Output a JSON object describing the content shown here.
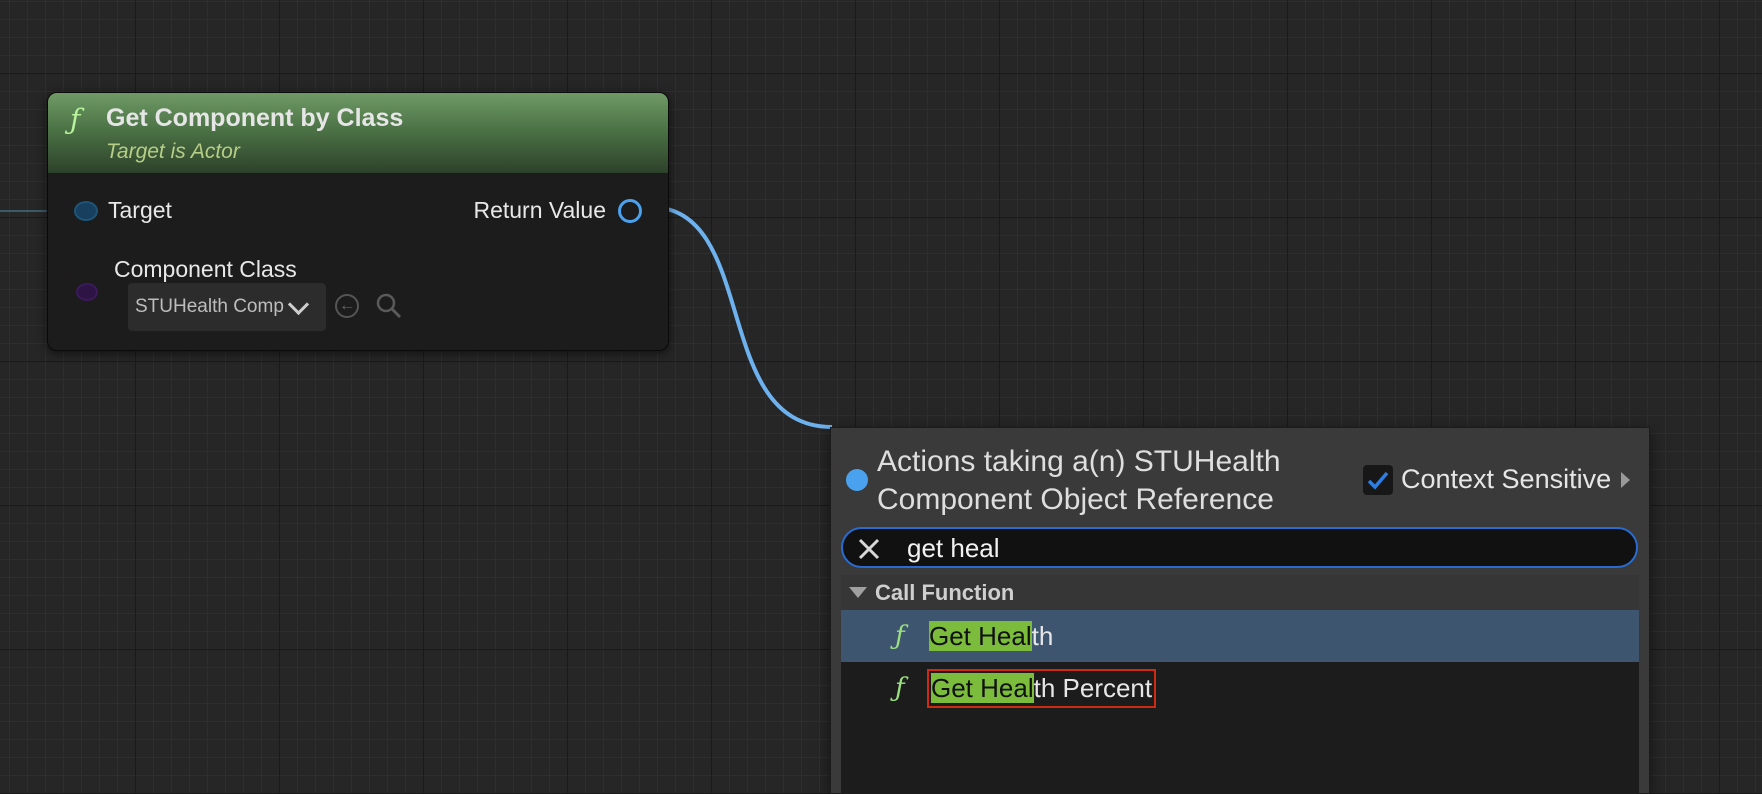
{
  "node": {
    "function_icon": "function-icon",
    "title": "Get Component by Class",
    "subtitle": "Target is Actor",
    "pins": {
      "target": "Target",
      "return_value": "Return Value",
      "component_class": "Component Class"
    },
    "class_value": "STUHealth Comp",
    "icons": [
      "use-selected-asset-icon",
      "browse-icon",
      "chevron-down-icon"
    ]
  },
  "action_menu": {
    "title": "Actions taking a(n) STUHealth Component Object Reference",
    "context_sensitive_label": "Context Sensitive",
    "context_sensitive_checked": true,
    "search_value": "get heal",
    "categories": [
      {
        "label": "Call Function",
        "items": [
          {
            "highlight": "Get Heal",
            "rest": "th",
            "selected": true
          },
          {
            "highlight": "Get Heal",
            "rest": "th Percent",
            "selected": false,
            "outlined": true
          }
        ]
      }
    ]
  },
  "colors": {
    "wire": "#6db2ee",
    "node_header": "#4c7346",
    "highlight": "#7cbc3c",
    "selection": "#3e5570",
    "search_border": "#2a6bd0",
    "outline_marker": "#cc2a12"
  }
}
